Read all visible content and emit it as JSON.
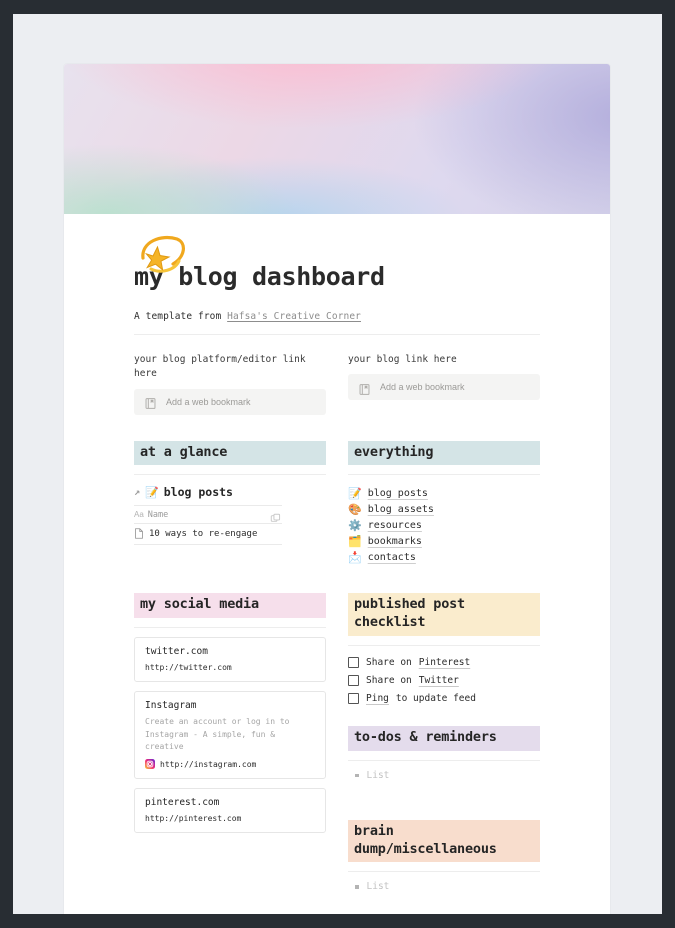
{
  "page": {
    "title": "my blog dashboard",
    "byline_prefix": "A template from",
    "byline_link": "Hafsa's Creative Corner",
    "icon": "shooting-star-emoji"
  },
  "bookmarks_row": {
    "left": {
      "label": "your blog platform/editor link here",
      "stub_text": "Add a web bookmark",
      "stub_icon": "bookmark-icon"
    },
    "right": {
      "label": "your blog link here",
      "stub_text": "Add a web bookmark",
      "stub_icon": "bookmark-icon"
    }
  },
  "at_a_glance": {
    "heading": "at a glance",
    "database": {
      "link_icon": "arrow-up-right-icon",
      "emoji": "📝",
      "name": "blog posts",
      "column_header": "Name",
      "column_type_icon": "Aa",
      "duplicate_icon": "duplicate-icon",
      "rows": [
        {
          "icon": "page-icon",
          "title": "10 ways to re-engage"
        }
      ]
    }
  },
  "everything": {
    "heading": "everything",
    "items": [
      {
        "emoji": "📝",
        "label": "blog posts",
        "icon_name": "memo-icon"
      },
      {
        "emoji": "🎨",
        "label": "blog assets",
        "icon_name": "palette-icon"
      },
      {
        "emoji": "⚙️",
        "label": "resources",
        "icon_name": "gear-icon"
      },
      {
        "emoji": "🗂️",
        "label": "bookmarks",
        "icon_name": "folder-icon"
      },
      {
        "emoji": "📩",
        "label": "contacts",
        "icon_name": "envelope-icon"
      }
    ]
  },
  "social_media": {
    "heading": "my social media",
    "cards": [
      {
        "title": "twitter.com",
        "description": "",
        "url": "http://twitter.com",
        "favicon": "none"
      },
      {
        "title": "Instagram",
        "description": "Create an account or log in to Instagram - A simple, fun & creative",
        "url": "http://instagram.com",
        "favicon": "instagram-icon"
      },
      {
        "title": "pinterest.com",
        "description": "",
        "url": "http://pinterest.com",
        "favicon": "none"
      }
    ]
  },
  "checklist": {
    "heading": "published post checklist",
    "items": [
      {
        "prefix": "Share on",
        "link": "Pinterest",
        "suffix": "",
        "checked": false
      },
      {
        "prefix": "Share on",
        "link": "Twitter",
        "suffix": "",
        "checked": false
      },
      {
        "prefix": "",
        "link": "Ping",
        "suffix": "to update feed",
        "checked": false
      }
    ]
  },
  "todos": {
    "heading": "to-dos & reminders",
    "items": [
      {
        "label": "List"
      }
    ]
  },
  "brain_dump": {
    "heading": "brain dump/miscellaneous",
    "items": [
      {
        "label": "List"
      }
    ]
  },
  "colors": {
    "frame": "#282d33",
    "page_bg": "#eceef2",
    "card_bg": "#ffffff",
    "highlight_blue": "#d4e4e6",
    "highlight_pink": "#f6dfeb",
    "highlight_cream": "#faeccd",
    "highlight_lavender": "#e4dcec",
    "highlight_peach": "#f8ddcd"
  }
}
